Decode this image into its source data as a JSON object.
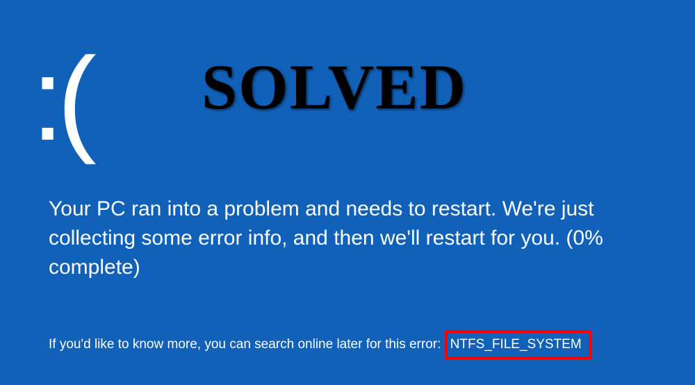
{
  "face": ":(",
  "overlay_title": "SOLVED",
  "message": "Your PC ran into a problem and needs to restart. We're just collecting some error info, and then we'll restart for you. (0% complete)",
  "footer_prefix": "If you'd like to know more, you can search online later for this error:",
  "error_code": "NTFS_FILE_SYSTEM"
}
